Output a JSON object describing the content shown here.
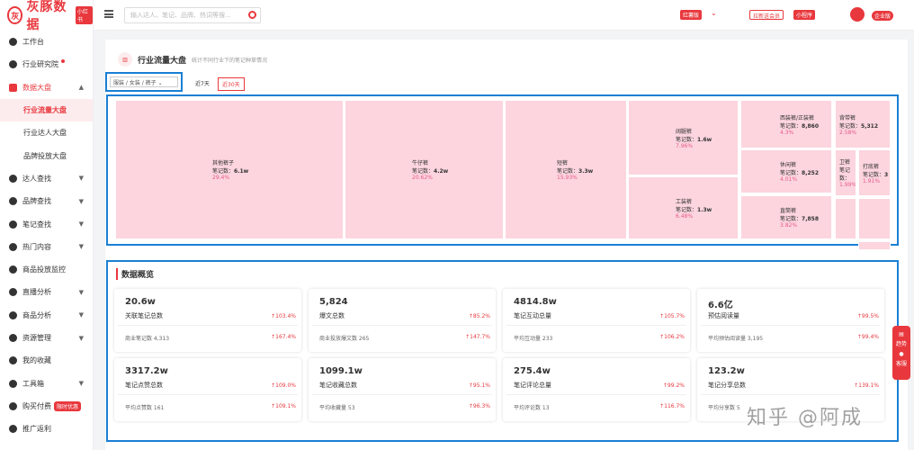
{
  "brand": {
    "name": "灰豚数据",
    "tag": "小红书"
  },
  "sidebar": {
    "items": [
      {
        "label": "工作台"
      },
      {
        "label": "行业研究院"
      },
      {
        "label": "数据大盘"
      },
      {
        "label": "行业流量大盘"
      },
      {
        "label": "行业达人大盘"
      },
      {
        "label": "品牌投放大盘"
      },
      {
        "label": "达人查找"
      },
      {
        "label": "品牌查找"
      },
      {
        "label": "笔记查找"
      },
      {
        "label": "热门内容"
      },
      {
        "label": "商品投放监控"
      },
      {
        "label": "直播分析"
      },
      {
        "label": "商品分析"
      },
      {
        "label": "资源管理"
      },
      {
        "label": "我的收藏"
      },
      {
        "label": "工具箱"
      },
      {
        "label": "购买付费",
        "badge": "限时优惠"
      },
      {
        "label": "推广返利"
      }
    ]
  },
  "topbar": {
    "search_placeholder": "输入达人、笔记、品牌、热词等搜...",
    "platform_badge": "红薯版",
    "upgrade_label": "拉新送会员",
    "miniprogram_label": "小程序",
    "enterprise_label": "企业版"
  },
  "page": {
    "title": "行业流量大盘",
    "subtitle": "统计不同行业下的笔记种草情况",
    "category": "服装 / 女装 / 裤子",
    "period_7": "近7天",
    "period_30": "近30天"
  },
  "treemap": [
    {
      "name": "其他裤子",
      "notes": "6.1w",
      "pct": "29.4%"
    },
    {
      "name": "牛仔裤",
      "notes": "4.2w",
      "pct": "20.62%"
    },
    {
      "name": "短裤",
      "notes": "3.3w",
      "pct": "15.93%"
    },
    {
      "name": "阔腿裤",
      "notes": "1.6w",
      "pct": "7.96%"
    },
    {
      "name": "工装裤",
      "notes": "1.3w",
      "pct": "6.48%"
    },
    {
      "name": "西装裤/正装裤",
      "notes": "8,860",
      "pct": "4.3%"
    },
    {
      "name": "休闲裤",
      "notes": "8,252",
      "pct": "4.01%"
    },
    {
      "name": "直筒裤",
      "notes": "7,858",
      "pct": "3.82%"
    },
    {
      "name": "背带裤",
      "notes": "5,312",
      "pct": "2.58%"
    },
    {
      "name": "卫裤",
      "notes": "",
      "pct": "1.99%"
    },
    {
      "name": "打底裤",
      "notes": "3",
      "pct": "1.91%"
    }
  ],
  "notes_prefix": "笔记数：",
  "overview": {
    "title": "数据概览",
    "cards": [
      {
        "value": "20.6w",
        "label": "关联笔记总数",
        "change": "103.4%",
        "sub": "商业笔记数 4,313",
        "sub_change": "167.4%"
      },
      {
        "value": "5,824",
        "label": "爆文总数",
        "change": "85.2%",
        "sub": "商业投放爆文数 265",
        "sub_change": "147.7%"
      },
      {
        "value": "4814.8w",
        "label": "笔记互动总量",
        "change": "105.7%",
        "sub": "平均互动量 233",
        "sub_change": "106.2%"
      },
      {
        "value": "6.6亿",
        "label": "预估阅读量",
        "change": "99.5%",
        "sub": "平均预估阅读量 3,195",
        "sub_change": "99.4%"
      },
      {
        "value": "3317.2w",
        "label": "笔记点赞总数",
        "change": "109.0%",
        "sub": "平均点赞数 161",
        "sub_change": "109.1%"
      },
      {
        "value": "1099.1w",
        "label": "笔记收藏总数",
        "change": "95.1%",
        "sub": "平均收藏量 53",
        "sub_change": "96.3%"
      },
      {
        "value": "275.4w",
        "label": "笔记评论总量",
        "change": "99.2%",
        "sub": "平均评论数 13",
        "sub_change": "116.7%"
      },
      {
        "value": "123.2w",
        "label": "笔记分享总数",
        "change": "139.1%",
        "sub": "平均分享数 5",
        "sub_change": ""
      }
    ]
  },
  "fab": {
    "a": "趋势",
    "b": "客服"
  },
  "watermark": "知乎 @阿成"
}
